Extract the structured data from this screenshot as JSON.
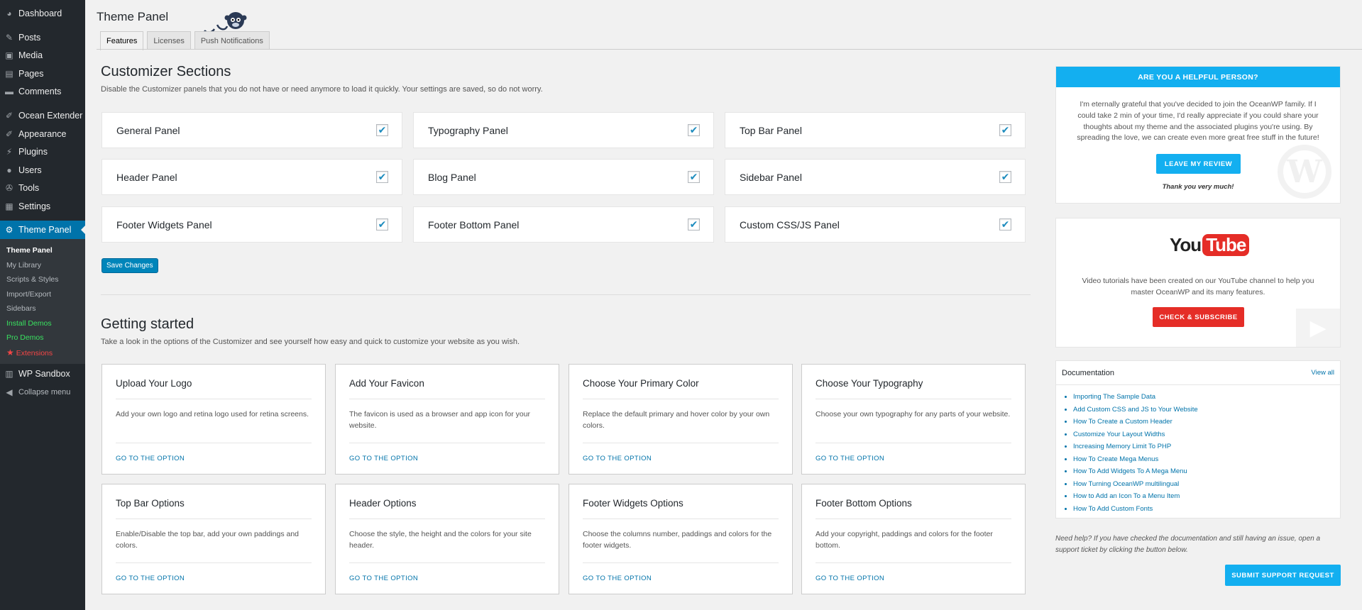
{
  "sidebar": {
    "items": [
      {
        "label": "Dashboard",
        "icon": "dashboard-icon"
      },
      {
        "label": "Posts",
        "icon": "pin-icon"
      },
      {
        "label": "Media",
        "icon": "media-icon"
      },
      {
        "label": "Pages",
        "icon": "page-icon"
      },
      {
        "label": "Comments",
        "icon": "comment-icon"
      },
      {
        "label": "Ocean Extender",
        "icon": "brush-icon"
      },
      {
        "label": "Appearance",
        "icon": "brush-icon"
      },
      {
        "label": "Plugins",
        "icon": "plug-icon"
      },
      {
        "label": "Users",
        "icon": "user-icon"
      },
      {
        "label": "Tools",
        "icon": "wrench-icon"
      },
      {
        "label": "Settings",
        "icon": "settings-icon"
      },
      {
        "label": "Theme Panel",
        "icon": "gear-icon"
      },
      {
        "label": "WP Sandbox",
        "icon": "sandbox-icon"
      },
      {
        "label": "Collapse menu",
        "icon": "collapse-icon"
      }
    ],
    "submenu": [
      "Theme Panel",
      "My Library",
      "Scripts & Styles",
      "Import/Export",
      "Sidebars",
      "Install Demos",
      "Pro Demos",
      "Extensions"
    ]
  },
  "header": {
    "title": "Theme Panel",
    "tabs": [
      "Features",
      "Licenses",
      "Push Notifications"
    ]
  },
  "customizer": {
    "title": "Customizer Sections",
    "description": "Disable the Customizer panels that you do not have or need anymore to load it quickly. Your settings are saved, so do not worry.",
    "panels": [
      {
        "label": "General Panel",
        "checked": true
      },
      {
        "label": "Typography Panel",
        "checked": true
      },
      {
        "label": "Top Bar Panel",
        "checked": true
      },
      {
        "label": "Header Panel",
        "checked": true
      },
      {
        "label": "Blog Panel",
        "checked": true
      },
      {
        "label": "Sidebar Panel",
        "checked": true
      },
      {
        "label": "Footer Widgets Panel",
        "checked": true
      },
      {
        "label": "Footer Bottom Panel",
        "checked": true
      },
      {
        "label": "Custom CSS/JS Panel",
        "checked": true
      }
    ],
    "save_label": "Save Changes",
    "check_glyph": "✔"
  },
  "getting_started": {
    "title": "Getting started",
    "description": "Take a look in the options of the Customizer and see yourself how easy and quick to customize your website as you wish.",
    "link_label": "GO TO THE OPTION",
    "cards": [
      {
        "title": "Upload Your Logo",
        "desc": "Add your own logo and retina logo used for retina screens."
      },
      {
        "title": "Add Your Favicon",
        "desc": "The favicon is used as a browser and app icon for your website."
      },
      {
        "title": "Choose Your Primary Color",
        "desc": "Replace the default primary and hover color by your own colors."
      },
      {
        "title": "Choose Your Typography",
        "desc": "Choose your own typography for any parts of your website."
      },
      {
        "title": "Top Bar Options",
        "desc": "Enable/Disable the top bar, add your own paddings and colors."
      },
      {
        "title": "Header Options",
        "desc": "Choose the style, the height and the colors for your site header."
      },
      {
        "title": "Footer Widgets Options",
        "desc": "Choose the columns number, paddings and colors for the footer widgets."
      },
      {
        "title": "Footer Bottom Options",
        "desc": "Add your copyright, paddings and colors for the footer bottom."
      }
    ]
  },
  "review_box": {
    "heading": "ARE YOU A HELPFUL PERSON?",
    "text": "I'm eternally grateful that you've decided to join the OceanWP family. If I could take 2 min of your time, I'd really appreciate if you could share your thoughts about my theme and the associated plugins you're using. By spreading the love, we can create even more great free stuff in the future!",
    "button": "LEAVE MY REVIEW",
    "thanks": "Thank you very much!",
    "watermark": "W"
  },
  "youtube_box": {
    "logo_you": "You",
    "logo_tube": "Tube",
    "text": "Video tutorials have been created on our YouTube channel to help you master OceanWP and its many features.",
    "button": "CHECK & SUBSCRIBE"
  },
  "docs": {
    "title": "Documentation",
    "view_all": "View all",
    "links": [
      "Importing The Sample Data",
      "Add Custom CSS and JS to Your Website",
      "How To Create a Custom Header",
      "Customize Your Layout Widths",
      "Increasing Memory Limit To PHP",
      "How To Create Mega Menus",
      "How To Add Widgets To A Mega Menu",
      "How Turning OceanWP multilingual",
      "How to Add an Icon To a Menu Item",
      "How To Add Custom Fonts"
    ],
    "help_text": "Need help? If you have checked the documentation and still having an issue, open a support ticket by clicking the button below.",
    "support_button": "SUBMIT SUPPORT REQUEST"
  },
  "colors": {
    "accent_blue": "#13aff0",
    "wp_blue": "#0073aa",
    "youtube_red": "#e52d27",
    "sidebar_dark": "#23282d"
  }
}
